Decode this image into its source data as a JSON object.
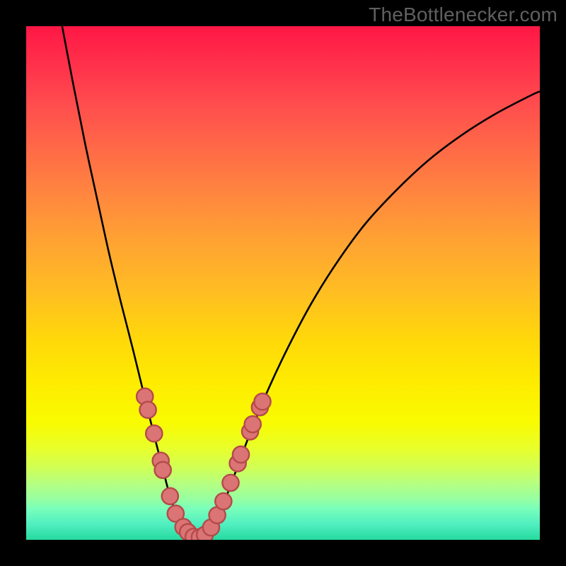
{
  "watermark": "TheBottlenecker.com",
  "chart_data": {
    "type": "line",
    "title": "",
    "xlabel": "",
    "ylabel": "",
    "xlim": [
      0,
      1
    ],
    "ylim": [
      0,
      1
    ],
    "grid": false,
    "background": "rainbow-vertical",
    "curve_points": [
      {
        "x": 0.07,
        "y": 1.0
      },
      {
        "x": 0.092,
        "y": 0.885
      },
      {
        "x": 0.115,
        "y": 0.77
      },
      {
        "x": 0.14,
        "y": 0.655
      },
      {
        "x": 0.162,
        "y": 0.555
      },
      {
        "x": 0.185,
        "y": 0.46
      },
      {
        "x": 0.208,
        "y": 0.37
      },
      {
        "x": 0.23,
        "y": 0.28
      },
      {
        "x": 0.25,
        "y": 0.2
      },
      {
        "x": 0.268,
        "y": 0.13
      },
      {
        "x": 0.283,
        "y": 0.075
      },
      {
        "x": 0.3,
        "y": 0.035
      },
      {
        "x": 0.32,
        "y": 0.01
      },
      {
        "x": 0.34,
        "y": 0.005
      },
      {
        "x": 0.358,
        "y": 0.018
      },
      {
        "x": 0.38,
        "y": 0.06
      },
      {
        "x": 0.405,
        "y": 0.125
      },
      {
        "x": 0.435,
        "y": 0.205
      },
      {
        "x": 0.47,
        "y": 0.29
      },
      {
        "x": 0.51,
        "y": 0.375
      },
      {
        "x": 0.555,
        "y": 0.46
      },
      {
        "x": 0.605,
        "y": 0.54
      },
      {
        "x": 0.66,
        "y": 0.615
      },
      {
        "x": 0.72,
        "y": 0.68
      },
      {
        "x": 0.782,
        "y": 0.738
      },
      {
        "x": 0.848,
        "y": 0.788
      },
      {
        "x": 0.915,
        "y": 0.83
      },
      {
        "x": 0.982,
        "y": 0.865
      },
      {
        "x": 1.0,
        "y": 0.873
      }
    ],
    "marker_points": [
      {
        "x": 0.231,
        "y": 0.279
      },
      {
        "x": 0.237,
        "y": 0.253
      },
      {
        "x": 0.249,
        "y": 0.207
      },
      {
        "x": 0.262,
        "y": 0.154
      },
      {
        "x": 0.266,
        "y": 0.136
      },
      {
        "x": 0.28,
        "y": 0.085
      },
      {
        "x": 0.291,
        "y": 0.051
      },
      {
        "x": 0.306,
        "y": 0.025
      },
      {
        "x": 0.315,
        "y": 0.015
      },
      {
        "x": 0.326,
        "y": 0.006
      },
      {
        "x": 0.338,
        "y": 0.005
      },
      {
        "x": 0.348,
        "y": 0.01
      },
      {
        "x": 0.36,
        "y": 0.024
      },
      {
        "x": 0.372,
        "y": 0.048
      },
      {
        "x": 0.384,
        "y": 0.075
      },
      {
        "x": 0.398,
        "y": 0.111
      },
      {
        "x": 0.412,
        "y": 0.149
      },
      {
        "x": 0.418,
        "y": 0.166
      },
      {
        "x": 0.436,
        "y": 0.211
      },
      {
        "x": 0.441,
        "y": 0.225
      },
      {
        "x": 0.455,
        "y": 0.258
      },
      {
        "x": 0.46,
        "y": 0.269
      }
    ],
    "marker_radius": 0.016
  }
}
